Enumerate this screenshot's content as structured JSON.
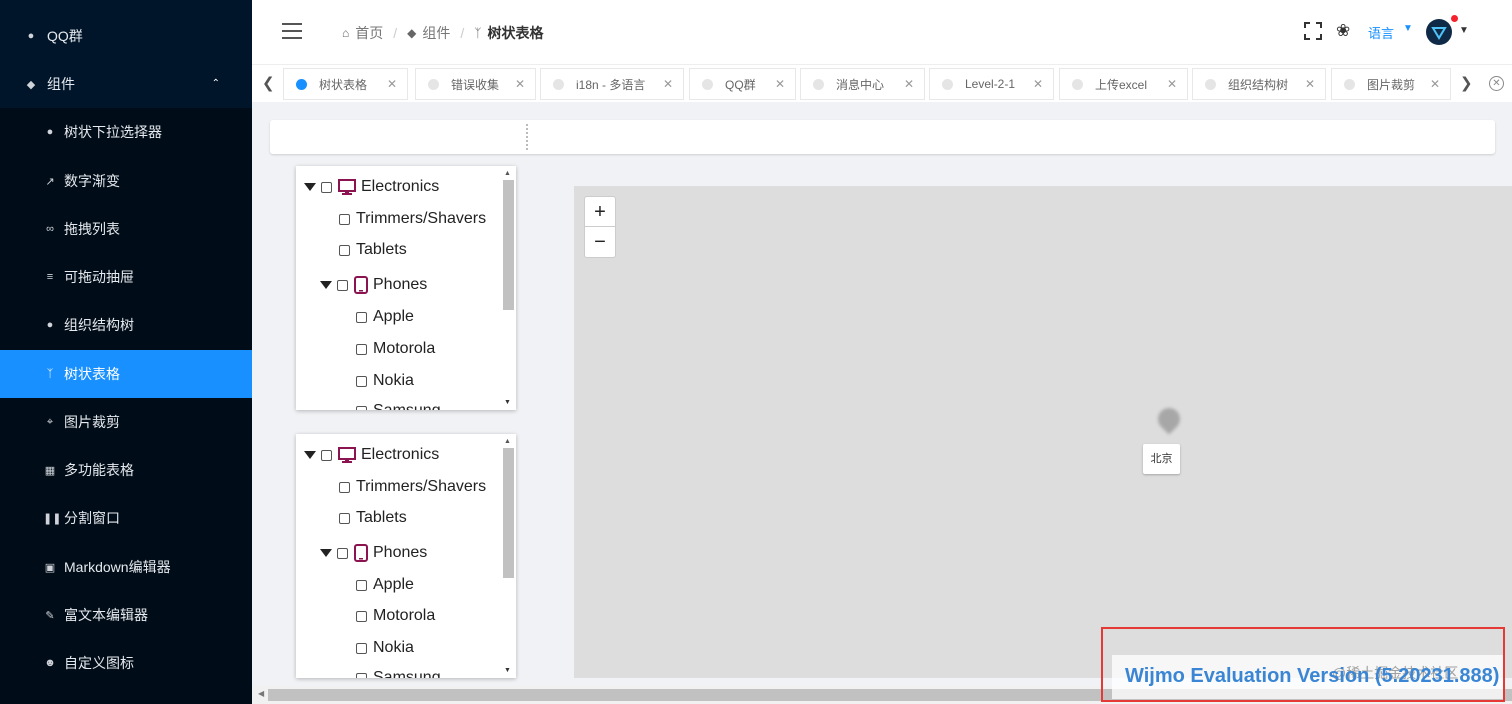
{
  "sidebar": {
    "top_items": [
      {
        "label": "QQ群",
        "icon": "bell-icon"
      },
      {
        "label": "组件",
        "icon": "layers-icon"
      }
    ],
    "items": [
      {
        "label": "树状下拉选择器",
        "icon": "circle-down-icon"
      },
      {
        "label": "数字渐变",
        "icon": "trend-icon"
      },
      {
        "label": "拖拽列表",
        "icon": "infinity-icon"
      },
      {
        "label": "可拖动抽屉",
        "icon": "lines-icon"
      },
      {
        "label": "组织结构树",
        "icon": "team-icon"
      },
      {
        "label": "树状表格",
        "icon": "branch-icon"
      },
      {
        "label": "图片裁剪",
        "icon": "crop-icon"
      },
      {
        "label": "多功能表格",
        "icon": "table-icon"
      },
      {
        "label": "分割窗口",
        "icon": "pause-icon"
      },
      {
        "label": "Markdown编辑器",
        "icon": "markdown-icon"
      },
      {
        "label": "富文本编辑器",
        "icon": "edit-icon"
      },
      {
        "label": "自定义图标",
        "icon": "emoji-icon"
      }
    ],
    "active_index": 5,
    "colors": {
      "bg": "#001529",
      "submenu_bg": "#000c17",
      "active": "#1890ff"
    }
  },
  "header": {
    "breadcrumbs": [
      "首页",
      "组件",
      "树状表格"
    ],
    "language": "语言"
  },
  "tabs": [
    {
      "label": "树状表格",
      "active": true
    },
    {
      "label": "错误收集",
      "active": false
    },
    {
      "label": "i18n - 多语言",
      "active": false
    },
    {
      "label": "QQ群",
      "active": false
    },
    {
      "label": "消息中心",
      "active": false
    },
    {
      "label": "Level-2-1",
      "active": false
    },
    {
      "label": "上传excel",
      "active": false
    },
    {
      "label": "组织结构树",
      "active": false
    },
    {
      "label": "图片裁剪",
      "active": false
    }
  ],
  "trees": [
    {
      "root": "Electronics",
      "items": [
        "Trimmers/Shavers",
        "Tablets"
      ],
      "group": "Phones",
      "children": [
        "Apple",
        "Motorola",
        "Nokia",
        "Samsung"
      ]
    },
    {
      "root": "Electronics",
      "items": [
        "Trimmers/Shavers",
        "Tablets"
      ],
      "group": "Phones",
      "children": [
        "Apple",
        "Motorola",
        "Nokia",
        "Samsung"
      ]
    }
  ],
  "map": {
    "zoom_in": "+",
    "zoom_out": "−",
    "marker_label": "北京"
  },
  "watermark": {
    "text": "Wijmo Evaluation Version (5.20231.888)",
    "credit": "@稀土掘金技术社区"
  }
}
